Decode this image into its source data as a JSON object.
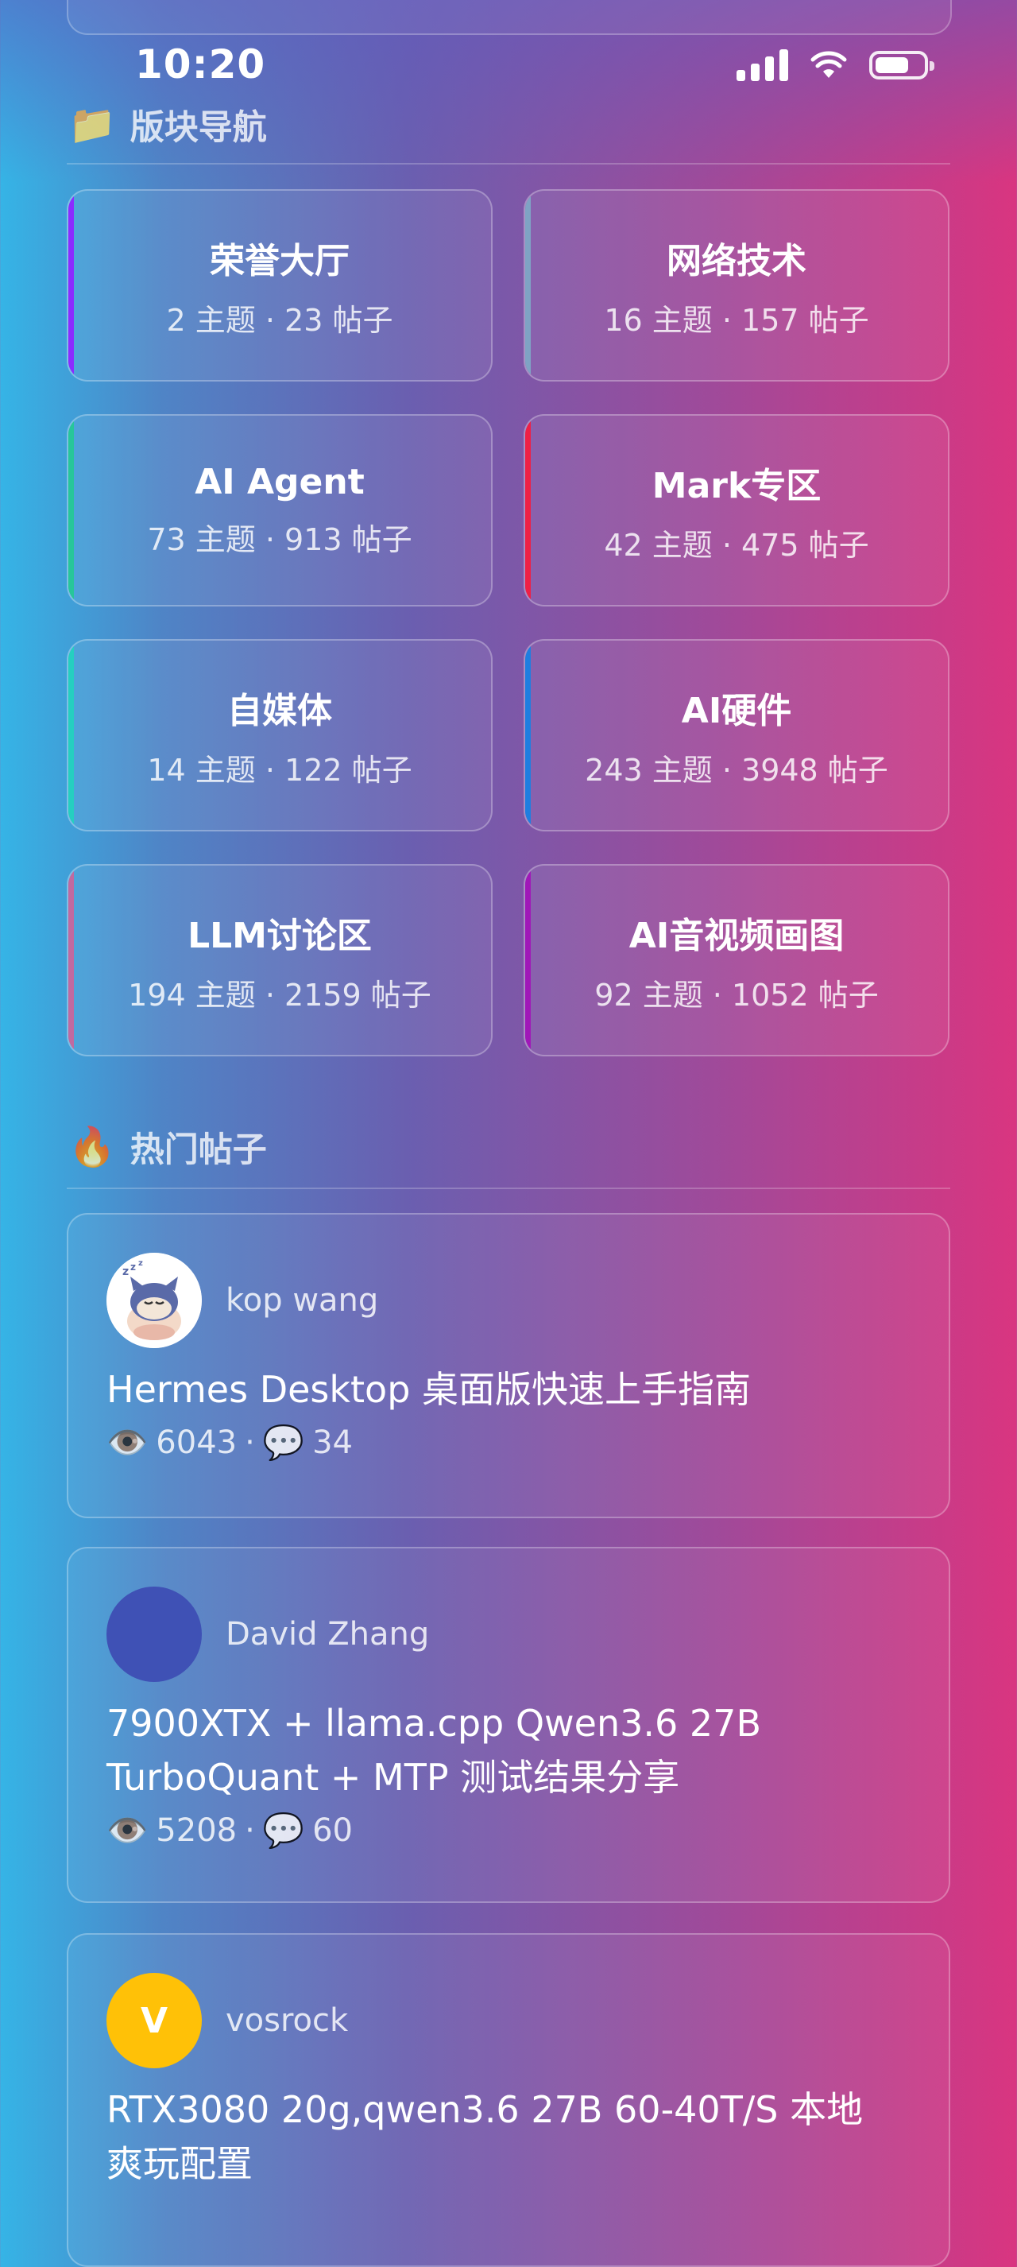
{
  "status_bar": {
    "time": "10:20"
  },
  "boards_section": {
    "icon": "folder-icon",
    "emoji": "📁",
    "title": "版块导航"
  },
  "boards": [
    {
      "name": "荣誉大厅",
      "stats": "2 主题 · 23 帖子",
      "accent": "#8b2cff"
    },
    {
      "name": "网络技术",
      "stats": "16 主题 · 157 帖子",
      "accent": "#7fa3c4"
    },
    {
      "name": "AI Agent",
      "stats": "73 主题 · 913 帖子",
      "accent": "#27c69a"
    },
    {
      "name": "Mark专区",
      "stats": "42 主题 · 475 帖子",
      "accent": "#ee2046"
    },
    {
      "name": "自媒体",
      "stats": "14 主题 · 122 帖子",
      "accent": "#25cfc0"
    },
    {
      "name": "AI硬件",
      "stats": "243 主题 · 3948 帖子",
      "accent": "#1f7ee0"
    },
    {
      "name": "LLM讨论区",
      "stats": "194 主题 · 2159 帖子",
      "accent": "#c06aa0"
    },
    {
      "name": "AI音视频画图",
      "stats": "92 主题 · 1052 帖子",
      "accent": "#a018b8"
    }
  ],
  "hot_section": {
    "icon": "fire-icon",
    "emoji": "🔥",
    "title": "热门帖子"
  },
  "posts": [
    {
      "author": "kop wang",
      "avatar_type": "sleeping-cat-avatar",
      "title_lines": [
        "Hermes Desktop 桌面版快速上手指南"
      ],
      "views": "6043",
      "comments": "34"
    },
    {
      "author": "David Zhang",
      "avatar_color": "#3f51b5",
      "title_lines": [
        "7900XTX + llama.cpp Qwen3.6 27B",
        "TurboQuant + MTP 测试结果分享"
      ],
      "views": "5208",
      "comments": "60"
    },
    {
      "author": "vosrock",
      "avatar_color": "#ffc107",
      "avatar_letter": "V",
      "title_lines": [
        "RTX3080 20g,qwen3.6 27B 60-40T/S 本地",
        "爽玩配置"
      ],
      "views": "",
      "comments": ""
    }
  ],
  "meta_icons": {
    "views": "eye-icon",
    "comments": "speech-bubble-icon",
    "views_glyph": "👁️",
    "comments_glyph": "💬",
    "separator": "·"
  }
}
